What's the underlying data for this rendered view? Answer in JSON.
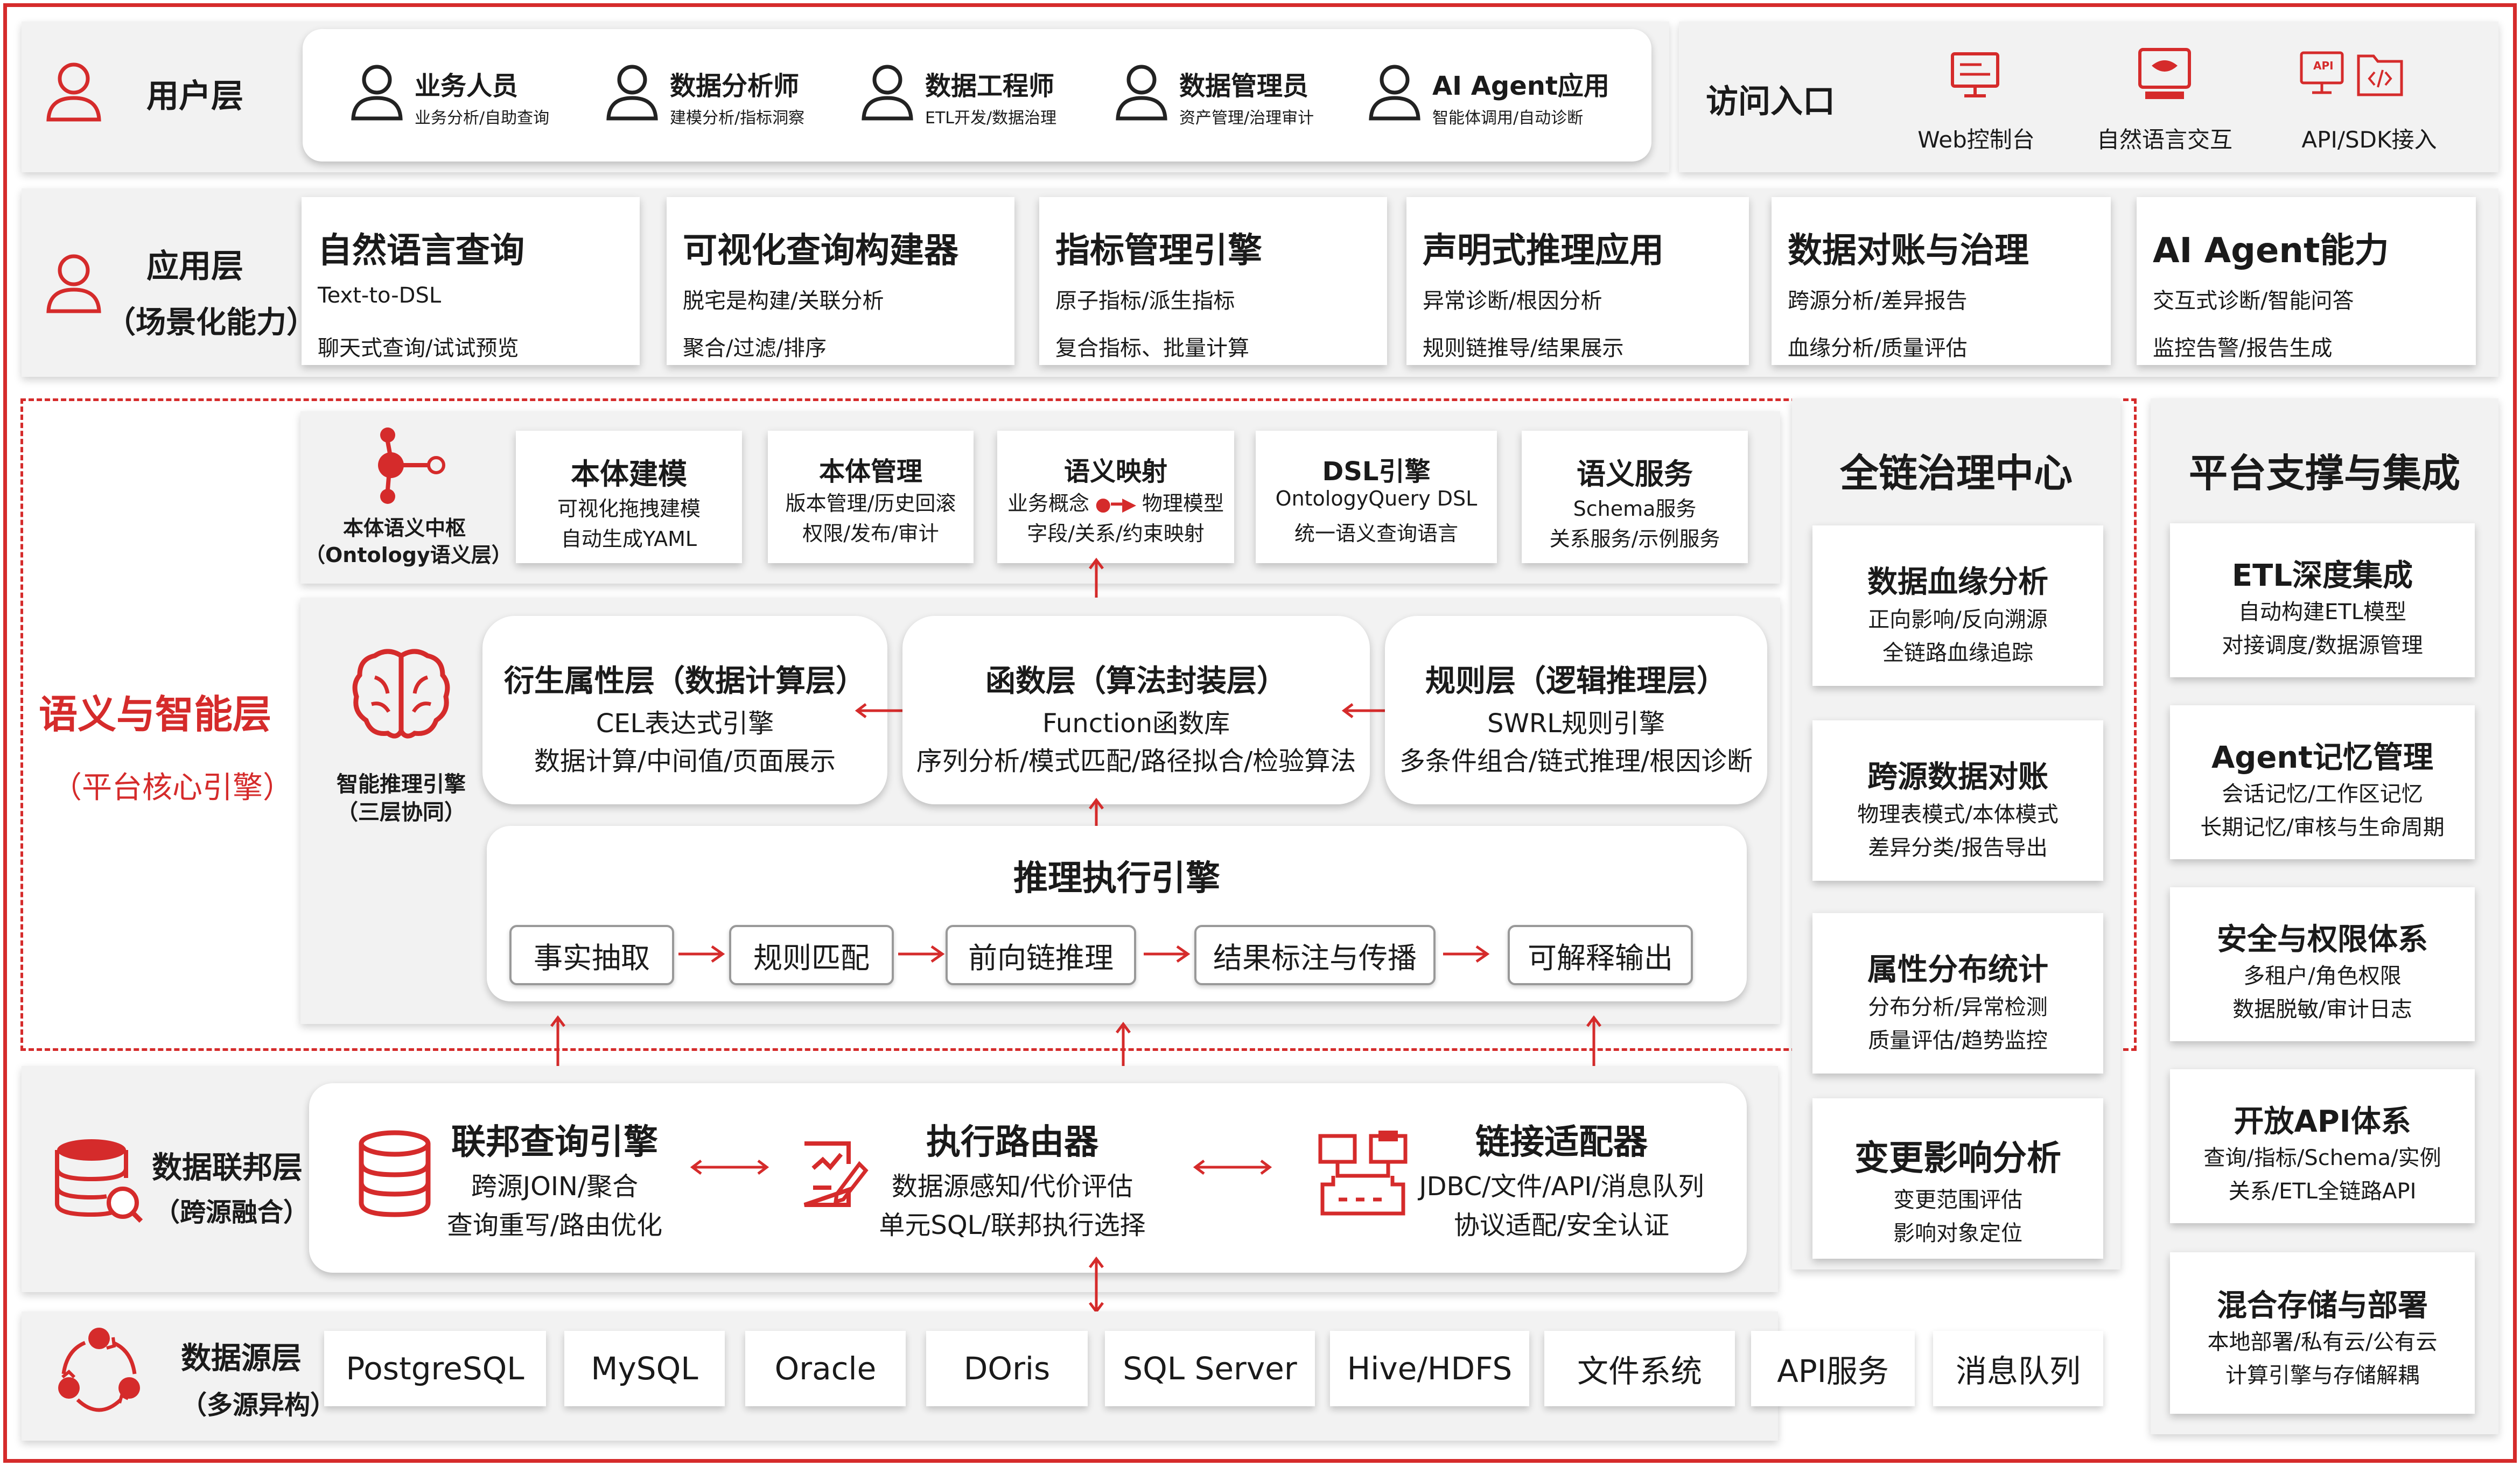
{
  "colors": {
    "accent": "#d52b2b",
    "band": "#f2f2f2",
    "card": "#ffffff",
    "text": "#1a1a1a"
  },
  "user_layer": {
    "title": "用户层",
    "icon": "user-icon",
    "users": [
      {
        "name": "业务人员",
        "desc": "业务分析/自助查询"
      },
      {
        "name": "数据分析师",
        "desc": "建模分析/指标洞察"
      },
      {
        "name": "数据工程师",
        "desc": "ETL开发/数据治理"
      },
      {
        "name": "数据管理员",
        "desc": "资产管理/治理审计"
      },
      {
        "name": "AI Agent应用",
        "desc": "智能体调用/自动诊断"
      }
    ]
  },
  "access": {
    "title": "访问入口",
    "items": [
      {
        "label": "Web控制台",
        "icon": "web-console-icon"
      },
      {
        "label": "自然语言交互",
        "icon": "natural-language-icon"
      },
      {
        "label": "API/SDK接入",
        "icon": "api-sdk-icon",
        "badge": "API"
      }
    ]
  },
  "app_layer": {
    "title": "应用层",
    "subtitle": "（场景化能力）",
    "cards": [
      {
        "title": "自然语言查询",
        "l1": "Text-to-DSL",
        "l2": "聊天式查询/试试预览"
      },
      {
        "title": "可视化查询构建器",
        "l1": "脱宅是构建/关联分析",
        "l2": "聚合/过滤/排序"
      },
      {
        "title": "指标管理引擎",
        "l1": "原子指标/派生指标",
        "l2": "复合指标、批量计算"
      },
      {
        "title": "声明式推理应用",
        "l1": "异常诊断/根因分析",
        "l2": "规则链推导/结果展示"
      },
      {
        "title": "数据对账与治理",
        "l1": "跨源分析/差异报告",
        "l2": "血缘分析/质量评估"
      },
      {
        "title": "AI Agent能力",
        "l1": "交互式诊断/智能问答",
        "l2": "监控告警/报告生成"
      }
    ]
  },
  "semantic_layer": {
    "title": "语义与智能层",
    "subtitle": "（平台核心引擎）",
    "ontology": {
      "label1": "本体语义中枢",
      "label2": "（Ontology语义层）",
      "cards": [
        {
          "title": "本体建模",
          "l1": "可视化拖拽建模",
          "l2": "自动生成YAML"
        },
        {
          "title": "本体管理",
          "l1": "版本管理/历史回滚",
          "l2": "权限/发布/审计"
        },
        {
          "title": "语义映射",
          "l1a": "业务概念",
          "l1b": "物理模型",
          "l2": "字段/关系/约束映射"
        },
        {
          "title": "DSL引擎",
          "l1": "OntologyQuery DSL",
          "l2": "统一语义查询语言"
        },
        {
          "title": "语义服务",
          "l1": "Schema服务",
          "l2": "关系服务/示例服务"
        }
      ]
    },
    "reasoning": {
      "label1": "智能推理引擎",
      "label2": "（三层协同）",
      "cards": [
        {
          "title": "衍生属性层（数据计算层）",
          "l1": "CEL表达式引擎",
          "l2": "数据计算/中间值/页面展示"
        },
        {
          "title": "函数层（算法封装层）",
          "l1": "Function函数库",
          "l2": "序列分析/模式匹配/路径拟合/检验算法"
        },
        {
          "title": "规则层（逻辑推理层）",
          "l1": "SWRL规则引擎",
          "l2": "多条件组合/链式推理/根因诊断"
        }
      ],
      "engine": {
        "title": "推理执行引擎",
        "steps": [
          "事实抽取",
          "规则匹配",
          "前向链推理",
          "结果标注与传播",
          "可解释输出"
        ]
      }
    }
  },
  "governance": {
    "title": "全链治理中心",
    "cards": [
      {
        "title": "数据血缘分析",
        "l1": "正向影响/反向溯源",
        "l2": "全链路血缘追踪"
      },
      {
        "title": "跨源数据对账",
        "l1": "物理表模式/本体模式",
        "l2": "差异分类/报告导出"
      },
      {
        "title": "属性分布统计",
        "l1": "分布分析/异常检测",
        "l2": "质量评估/趋势监控"
      },
      {
        "title": "变更影响分析",
        "l1": "变更范围评估",
        "l2": "影响对象定位"
      }
    ]
  },
  "platform": {
    "title": "平台支撑与集成",
    "cards": [
      {
        "title": "ETL深度集成",
        "l1": "自动构建ETL模型",
        "l2": "对接调度/数据源管理"
      },
      {
        "title": "Agent记忆管理",
        "l1": "会话记忆/工作区记忆",
        "l2": "长期记忆/审核与生命周期"
      },
      {
        "title": "安全与权限体系",
        "l1": "多租户/角色权限",
        "l2": "数据脱敏/审计日志"
      },
      {
        "title": "开放API体系",
        "l1": "查询/指标/Schema/实例",
        "l2": "关系/ETL全链路API"
      },
      {
        "title": "混合存储与部署",
        "l1": "本地部署/私有云/公有云",
        "l2": "计算引擎与存储解耦"
      }
    ]
  },
  "federation": {
    "title": "数据联邦层",
    "subtitle": "（跨源融合）",
    "cards": [
      {
        "title": "联邦查询引擎",
        "l1": "跨源JOIN/聚合",
        "l2": "查询重写/路由优化"
      },
      {
        "title": "执行路由器",
        "l1": "数据源感知/代价评估",
        "l2": "单元SQL/联邦执行选择"
      },
      {
        "title": "链接适配器",
        "l1": "JDBC/文件/API/消息队列",
        "l2": "协议适配/安全认证"
      }
    ]
  },
  "sources": {
    "title": "数据源层",
    "subtitle": "（多源异构）",
    "items": [
      "PostgreSQL",
      "MySQL",
      "Oracle",
      "DOris",
      "SQL Server",
      "Hive/HDFS",
      "文件系统",
      "API服务",
      "消息队列"
    ]
  }
}
